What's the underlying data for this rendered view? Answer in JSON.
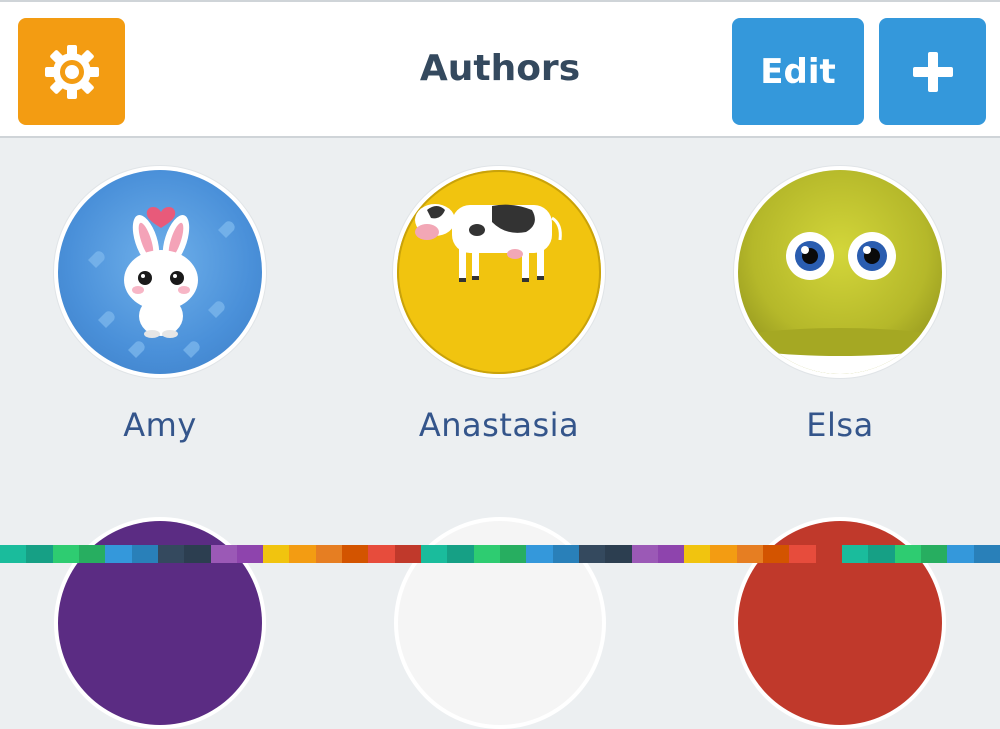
{
  "header": {
    "title": "Authors",
    "edit_label": "Edit",
    "settings_icon": "gear-icon",
    "add_icon": "plus-icon",
    "colors": {
      "settings": "#f39c12",
      "primary": "#3498db",
      "title": "#34495e"
    }
  },
  "authors": [
    {
      "name": "Amy",
      "avatar": "bunny-avatar",
      "bg": "#4a90d9"
    },
    {
      "name": "Anastasia",
      "avatar": "cow-avatar",
      "bg": "#f1c40f"
    },
    {
      "name": "Elsa",
      "avatar": "fuzzy-monster-avatar",
      "bg": "#b5b82a"
    }
  ],
  "more_authors_row": [
    {
      "avatar": "purple-avatar",
      "bg": "#5b2c83"
    },
    {
      "avatar": "white-avatar",
      "bg": "#f5f5f5"
    },
    {
      "avatar": "red-avatar",
      "bg": "#c0392b"
    }
  ],
  "palette": [
    "#1abc9c",
    "#16a085",
    "#2ecc71",
    "#27ae60",
    "#3498db",
    "#2980b9",
    "#34495e",
    "#2c3e50",
    "#9b59b6",
    "#8e44ad",
    "#f1c40f",
    "#f39c12",
    "#e67e22",
    "#d35400",
    "#e74c3c",
    "#c0392b",
    "#1abc9c",
    "#16a085",
    "#2ecc71",
    "#27ae60",
    "#3498db",
    "#2980b9",
    "#34495e",
    "#2c3e50",
    "#9b59b6",
    "#8e44ad",
    "#f1c40f",
    "#f39c12",
    "#e67e22",
    "#d35400",
    "#e74c3c",
    "#c0392b",
    "#1abc9c",
    "#16a085",
    "#2ecc71",
    "#27ae60",
    "#3498db",
    "#2980b9"
  ]
}
